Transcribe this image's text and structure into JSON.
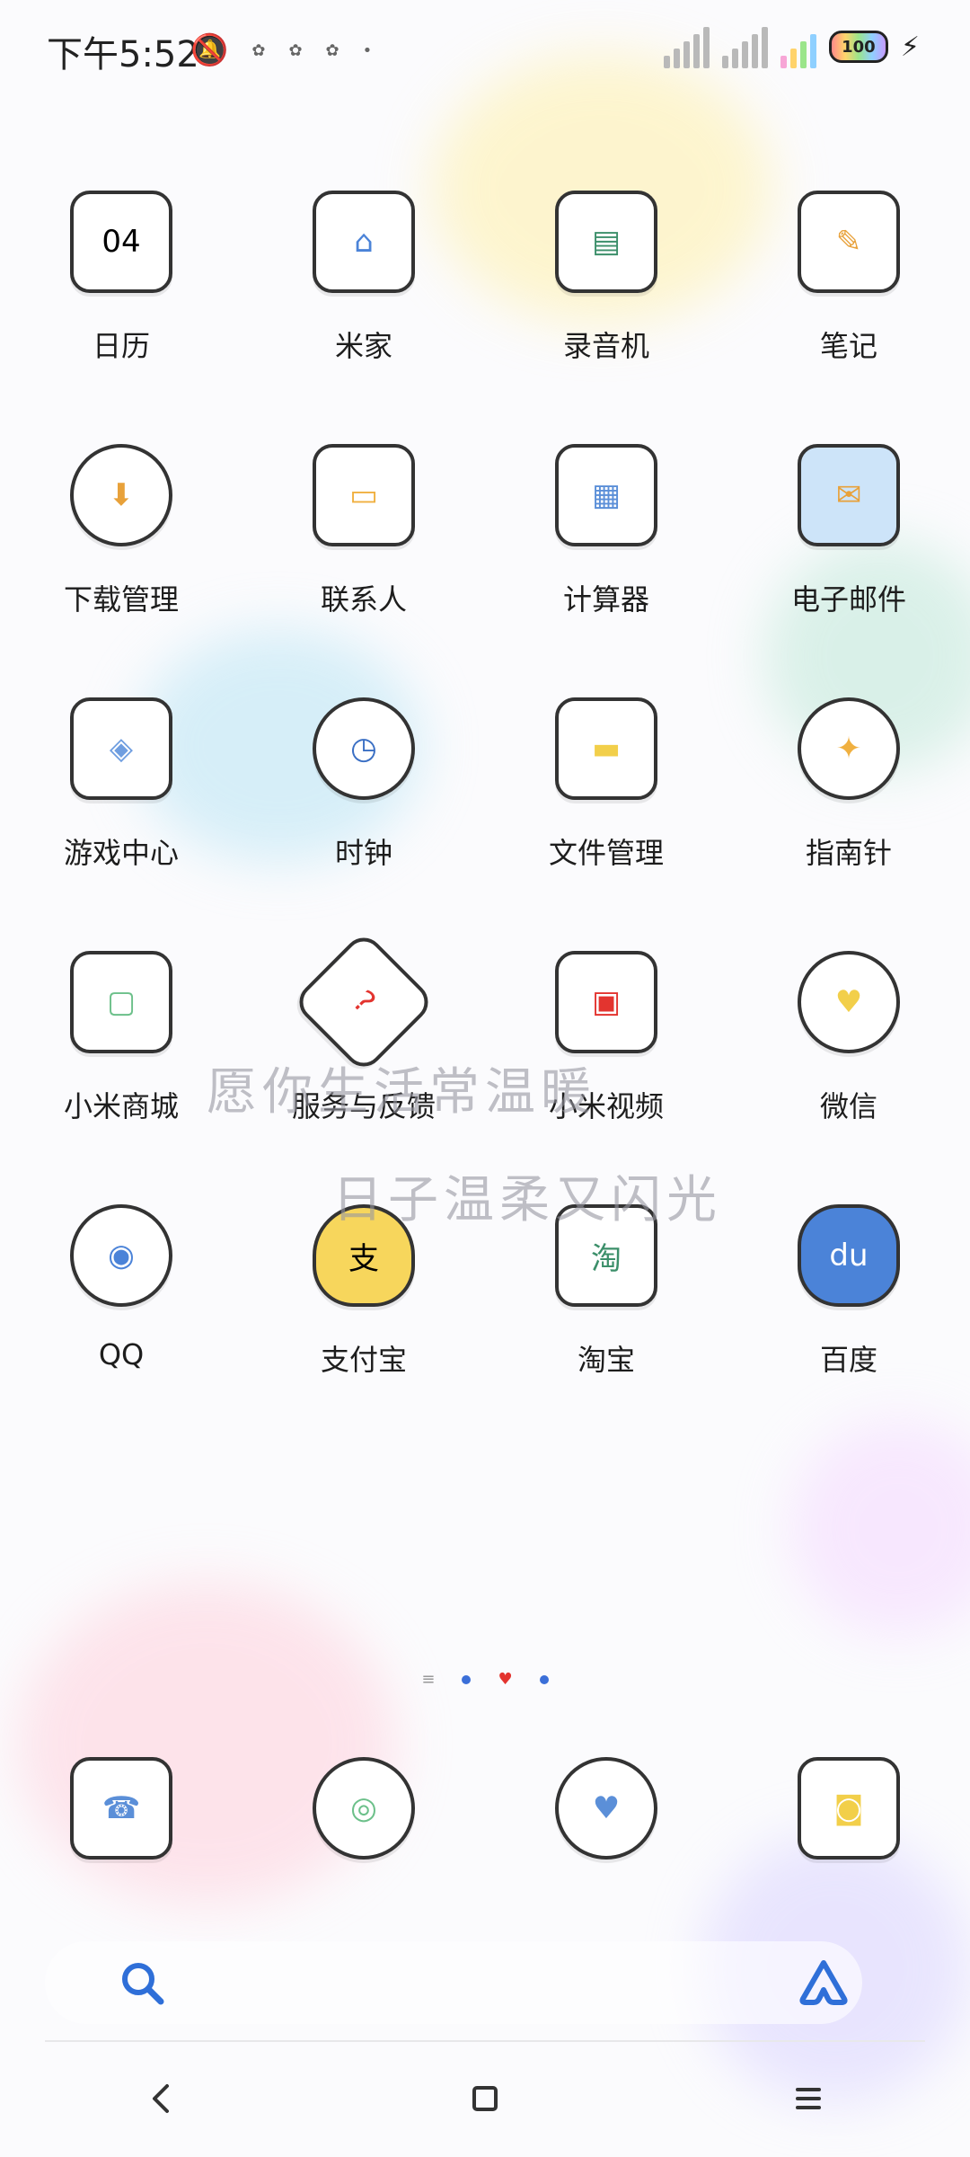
{
  "status_bar": {
    "time": "下午5:52",
    "battery": "100"
  },
  "apps": [
    [
      {
        "label": "日历",
        "glyph": "04"
      },
      {
        "label": "米家",
        "glyph": "⌂"
      },
      {
        "label": "录音机",
        "glyph": "▤"
      },
      {
        "label": "笔记",
        "glyph": "✎"
      }
    ],
    [
      {
        "label": "下载管理",
        "glyph": "⬇"
      },
      {
        "label": "联系人",
        "glyph": "▭"
      },
      {
        "label": "计算器",
        "glyph": "▦"
      },
      {
        "label": "电子邮件",
        "glyph": "✉"
      }
    ],
    [
      {
        "label": "游戏中心",
        "glyph": "◈"
      },
      {
        "label": "时钟",
        "glyph": "◷"
      },
      {
        "label": "文件管理",
        "glyph": "▬"
      },
      {
        "label": "指南针",
        "glyph": "✦"
      }
    ],
    [
      {
        "label": "小米商城",
        "glyph": "▢"
      },
      {
        "label": "服务与反馈",
        "glyph": "?"
      },
      {
        "label": "小米视频",
        "glyph": "▣"
      },
      {
        "label": "微信",
        "glyph": "♥"
      }
    ],
    [
      {
        "label": "QQ",
        "glyph": "◉"
      },
      {
        "label": "支付宝",
        "glyph": "支"
      },
      {
        "label": "淘宝",
        "glyph": "淘"
      },
      {
        "label": "百度",
        "glyph": "du"
      }
    ]
  ],
  "wallpaper_text": {
    "line1": "愿你生活常温暖",
    "line2": "日子温柔又闪光"
  },
  "dock": [
    {
      "name": "phone",
      "glyph": "☎"
    },
    {
      "name": "browser",
      "glyph": "◎"
    },
    {
      "name": "messages",
      "glyph": "♥"
    },
    {
      "name": "camera",
      "glyph": "◙"
    }
  ],
  "colors": {
    "accent_blue": "#2f6fd8",
    "heart_red": "#e3342f"
  }
}
